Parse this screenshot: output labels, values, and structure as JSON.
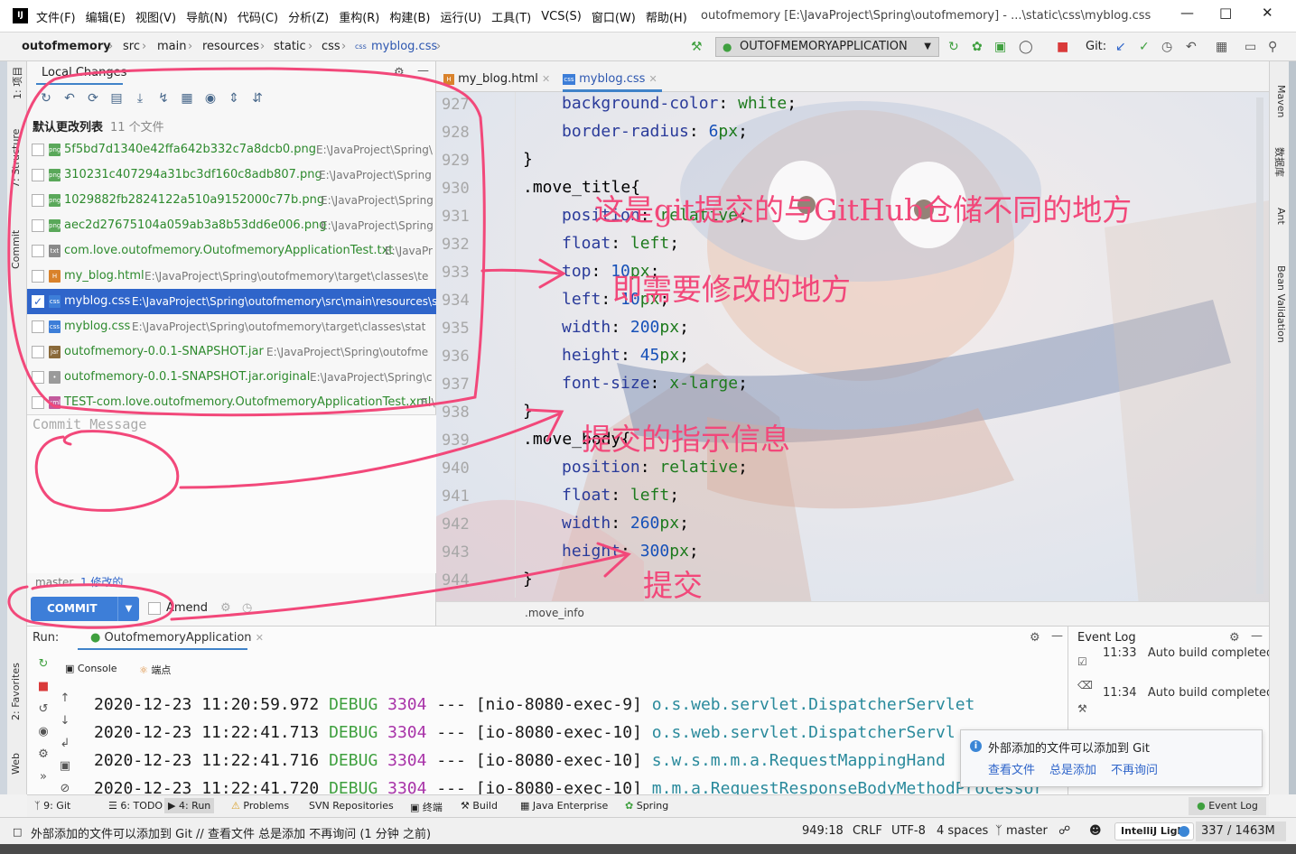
{
  "titlebar": {
    "logo": "IJ",
    "menu": [
      "文件(F)",
      "编辑(E)",
      "视图(V)",
      "导航(N)",
      "代码(C)",
      "分析(Z)",
      "重构(R)",
      "构建(B)",
      "运行(U)",
      "工具(T)",
      "VCS(S)",
      "窗口(W)",
      "帮助(H)"
    ],
    "window_title": "outofmemory [E:\\JavaProject\\Spring\\outofmemory] - ...\\static\\css\\myblog.css"
  },
  "navbar": {
    "breadcrumbs": [
      "outofmemory",
      "src",
      "main",
      "resources",
      "static",
      "css",
      "myblog.css"
    ],
    "run_config": "OUTOFMEMORYAPPLICATION",
    "git_label": "Git:"
  },
  "left_strip": [
    "1: 项目",
    "7: Structure",
    "Commit",
    "2: Favorites",
    "Web"
  ],
  "right_strip": [
    "Maven",
    "数据库",
    "Ant",
    "Bean Validation"
  ],
  "commit_panel": {
    "title": "Local Changes",
    "changelist_name": "默认更改列表",
    "changelist_count": "11 个文件",
    "files": [
      {
        "name": "5f5bd7d1340e42ffa642b332c7a8dcb0.png",
        "path": "E:\\JavaProject\\Spring\\",
        "type": "png",
        "checked": false
      },
      {
        "name": "310231c407294a31bc3df160c8adb807.png",
        "path": "E:\\JavaProject\\Spring",
        "type": "png",
        "checked": false
      },
      {
        "name": "1029882fb2824122a510a9152000c77b.png",
        "path": "E:\\JavaProject\\Spring",
        "type": "png",
        "checked": false
      },
      {
        "name": "aec2d27675104a059ab3a8b53dd6e006.png",
        "path": "E:\\JavaProject\\Spring",
        "type": "png",
        "checked": false
      },
      {
        "name": "com.love.outofmemory.OutofmemoryApplicationTest.txt",
        "path": "E:\\JavaPr",
        "type": "txt",
        "checked": false
      },
      {
        "name": "my_blog.html",
        "path": "E:\\JavaProject\\Spring\\outofmemory\\target\\classes\\te",
        "type": "html",
        "checked": false
      },
      {
        "name": "myblog.css",
        "path": "E:\\JavaProject\\Spring\\outofmemory\\src\\main\\resources\\static\\css",
        "type": "css",
        "checked": true
      },
      {
        "name": "myblog.css",
        "path": "E:\\JavaProject\\Spring\\outofmemory\\target\\classes\\stat",
        "type": "css",
        "checked": false
      },
      {
        "name": "outofmemory-0.0.1-SNAPSHOT.jar",
        "path": "E:\\JavaProject\\Spring\\outofme",
        "type": "jar",
        "checked": false
      },
      {
        "name": "outofmemory-0.0.1-SNAPSHOT.jar.original",
        "path": "E:\\JavaProject\\Spring\\c",
        "type": "file",
        "checked": false
      },
      {
        "name": "TEST-com.love.outofmemory.OutofmemoryApplicationTest.xml",
        "path": "E:\\",
        "type": "xml",
        "checked": false
      }
    ],
    "message_placeholder": "Commit Message",
    "branch": "master",
    "modified_count": "1 修改的",
    "commit_label": "COMMIT",
    "amend_label": "Amend"
  },
  "editor": {
    "tabs": [
      "my_blog.html",
      "myblog.css"
    ],
    "active_tab": 1,
    "lines": [
      {
        "num": "927",
        "prop": "background-color",
        "value": "white",
        "unit": ""
      },
      {
        "num": "928",
        "prop": "border-radius",
        "value": "6",
        "unit": "px"
      },
      {
        "num": "929",
        "text": "}"
      },
      {
        "num": "930",
        "selector": ".move_title{"
      },
      {
        "num": "931",
        "prop": "position",
        "value": "relative",
        "unit": ""
      },
      {
        "num": "932",
        "prop": "float",
        "value": "left",
        "unit": ""
      },
      {
        "num": "933",
        "prop": "top",
        "value": "10",
        "unit": "px"
      },
      {
        "num": "934",
        "prop": "left",
        "value": "10",
        "unit": "px"
      },
      {
        "num": "935",
        "prop": "width",
        "value": "200",
        "unit": "px"
      },
      {
        "num": "936",
        "prop": "height",
        "value": "45",
        "unit": "px"
      },
      {
        "num": "937",
        "prop": "font-size",
        "value": "x-large",
        "unit": ""
      },
      {
        "num": "938",
        "text": "}"
      },
      {
        "num": "939",
        "selector": ".move_body{"
      },
      {
        "num": "940",
        "prop": "position",
        "value": "relative",
        "unit": ""
      },
      {
        "num": "941",
        "prop": "float",
        "value": "left",
        "unit": ""
      },
      {
        "num": "942",
        "prop": "width",
        "value": "260",
        "unit": "px"
      },
      {
        "num": "943",
        "prop": "height",
        "value": "300",
        "unit": "px"
      },
      {
        "num": "944",
        "text": "}"
      }
    ],
    "breadcrumb": ".move_info"
  },
  "run_panel": {
    "label": "Run:",
    "app_tab": "OutofmemoryApplication",
    "subtabs": [
      "Console",
      "端点"
    ],
    "logs": [
      {
        "time": "2020-12-23 11:20:59.972",
        "level": "DEBUG",
        "pid": "3304",
        "sep": "---",
        "thread": "[nio-8080-exec-9]",
        "logger": "o.s.web.servlet.DispatcherServlet"
      },
      {
        "time": "2020-12-23 11:22:41.713",
        "level": "DEBUG",
        "pid": "3304",
        "sep": "---",
        "thread": "[io-8080-exec-10]",
        "logger": "o.s.web.servlet.DispatcherServl"
      },
      {
        "time": "2020-12-23 11:22:41.716",
        "level": "DEBUG",
        "pid": "3304",
        "sep": "---",
        "thread": "[io-8080-exec-10]",
        "logger": "s.w.s.m.m.a.RequestMappingHand"
      },
      {
        "time": "2020-12-23 11:22:41.720",
        "level": "DEBUG",
        "pid": "3304",
        "sep": "---",
        "thread": "[io-8080-exec-10]",
        "logger": "m.m.a.RequestResponseBodyMethodProcessor"
      }
    ]
  },
  "event_log": {
    "title": "Event Log",
    "entries": [
      {
        "time": "11:33",
        "text": "Auto build completed"
      },
      {
        "time": "11:34",
        "text": "Auto build completed"
      }
    ]
  },
  "notification": {
    "text": "外部添加的文件可以添加到 Git",
    "links": [
      "查看文件",
      "总是添加",
      "不再询问"
    ]
  },
  "bottom_tools": [
    "9: Git",
    "6: TODO",
    "4: Run",
    "Problems",
    "SVN Repositories",
    "终端",
    "Build",
    "Java Enterprise",
    "Spring"
  ],
  "event_log_button": "Event Log",
  "statusbar": {
    "message": "外部添加的文件可以添加到 Git // 查看文件   总是添加   不再询问 (1 分钟 之前)",
    "position": "949:18",
    "line_sep": "CRLF",
    "encoding": "UTF-8",
    "indent": "4 spaces",
    "branch": "master",
    "theme": "IntelliJ Light",
    "memory": "337 / 1463M"
  },
  "annotations": {
    "diff_note": "这是git提交的与GitHub仓储不同的地方",
    "modify_note": "即需要修改的地方",
    "message_note": "提交的指示信息",
    "commit_note": "提交"
  },
  "colors": {
    "accent": "#3d7ed8",
    "selection": "#2f65ca",
    "annotation": "#f2487a",
    "added_file": "#2d8a2d"
  }
}
